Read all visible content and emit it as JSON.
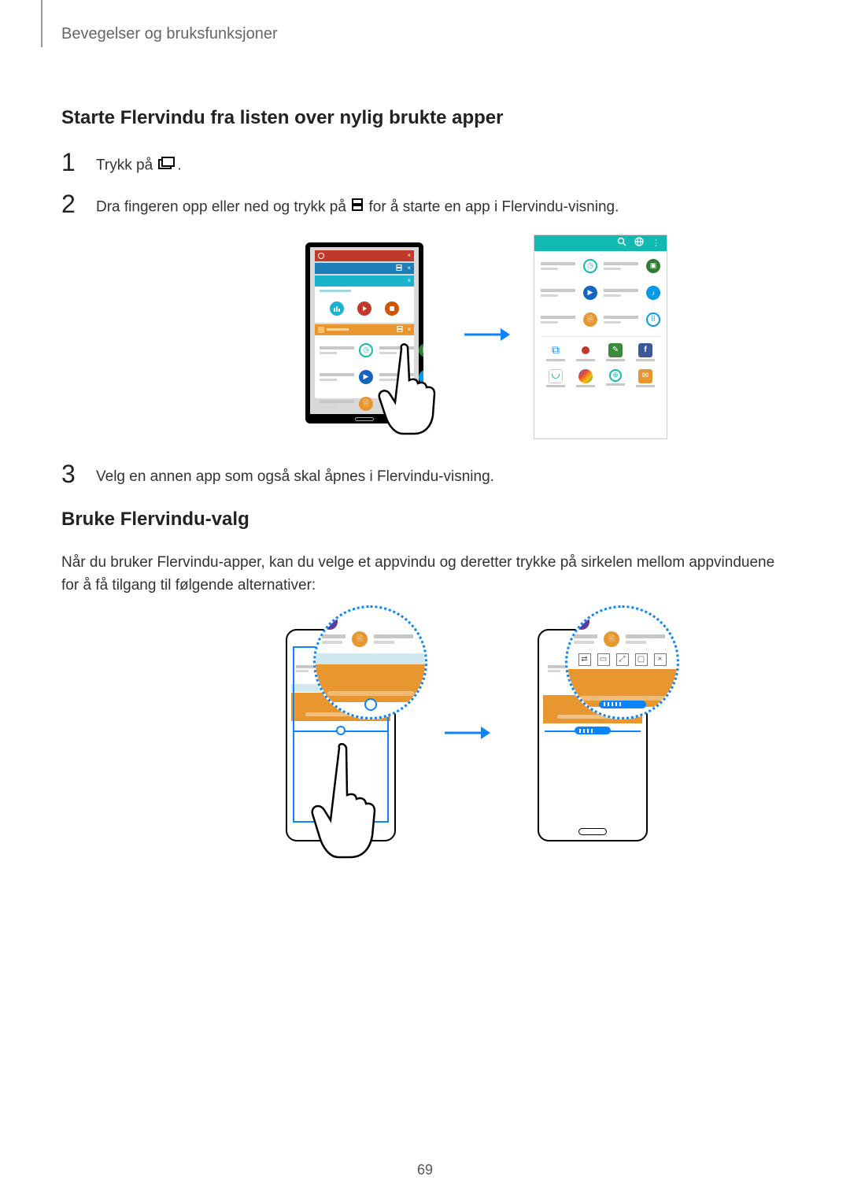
{
  "header": {
    "chapter": "Bevegelser og bruksfunksjoner"
  },
  "section1": {
    "title": "Starte Flervindu fra listen over nylig brukte apper",
    "step1_a": "Trykk på",
    "step1_b": ".",
    "step2_a": "Dra fingeren opp eller ned og trykk på",
    "step2_b": "for å starte en app i Flervindu-visning.",
    "step3": "Velg en annen app som også skal åpnes i Flervindu-visning."
  },
  "section2": {
    "title": "Bruke Flervindu-valg",
    "paragraph": "Når du bruker Flervindu-apper, kan du velge et appvindu og deretter trykke på sirkelen mellom appvinduene for å få tilgang til følgende alternativer:"
  },
  "steps": {
    "n1": "1",
    "n2": "2",
    "n3": "3"
  },
  "page_number": "69",
  "icons": {
    "recent_apps": "recent-apps-icon",
    "multiwindow": "multiwindow-split-icon",
    "search": "search-icon",
    "globe": "globe-icon",
    "more": "more-icon"
  }
}
